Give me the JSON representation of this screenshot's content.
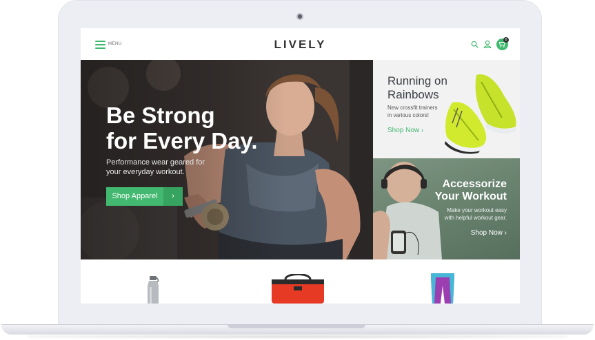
{
  "header": {
    "menu_label": "MENU",
    "logo": "LIVELY",
    "cart_count": "0",
    "icons": [
      "hamburger-icon",
      "search-icon",
      "user-icon",
      "cart-icon"
    ]
  },
  "hero": {
    "title_line1": "Be Strong",
    "title_line2": "for Every Day.",
    "subtitle_line1": "Performance wear geared for",
    "subtitle_line2": "your everyday workout.",
    "button_label": "Shop Apparel",
    "button_arrow": "›"
  },
  "promo_running": {
    "title_line1": "Running on",
    "title_line2": "Rainbows",
    "subtitle_line1": "New crossfit trainers",
    "subtitle_line2": "in various colors!",
    "link": "Shop Now",
    "link_arrow": "›"
  },
  "promo_accessorize": {
    "title_line1": "Accessorize",
    "title_line2": "Your Workout",
    "subtitle_line1": "Make your workout easy",
    "subtitle_line2": "with helpful workout gear.",
    "link": "Shop Now",
    "link_arrow": "›"
  },
  "products": [
    "water-bottle-icon",
    "gym-bag-icon",
    "leggings-icon"
  ],
  "colors": {
    "accent": "#43b870",
    "accent_dark": "#36a460",
    "laptop_frame": "#ededf4",
    "promo_bg": "#f2f2f2"
  }
}
